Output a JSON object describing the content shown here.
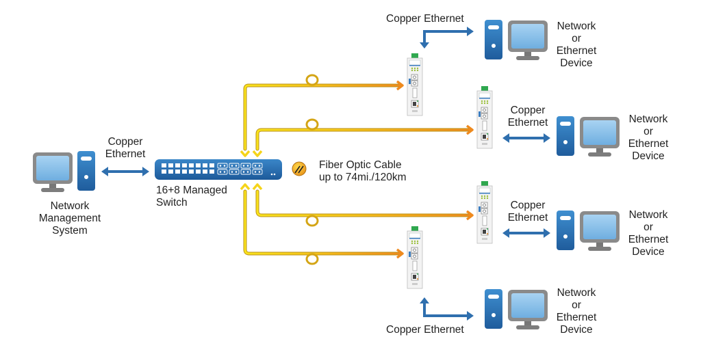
{
  "diagram": {
    "nms": {
      "label_lines": [
        "Network",
        "Management",
        "System"
      ]
    },
    "nms_link": {
      "label_lines": [
        "Copper",
        "Ethernet"
      ]
    },
    "switch": {
      "label_lines": [
        "16+8 Managed",
        "Switch"
      ],
      "copper_ports": 16,
      "fiber_ports": 8
    },
    "legend": {
      "icon": "fiber-optic-cable-icon",
      "label_lines": [
        "Fiber Optic Cable",
        "up to 74mi./120km"
      ]
    },
    "devices": [
      {
        "label_lines": [
          "Network",
          "or",
          "Ethernet",
          "Device"
        ],
        "link_label": "Copper Ethernet"
      },
      {
        "label_lines": [
          "Network",
          "or",
          "Ethernet",
          "Device"
        ],
        "link_label_lines": [
          "Copper",
          "Ethernet"
        ]
      },
      {
        "label_lines": [
          "Network",
          "or",
          "Ethernet",
          "Device"
        ],
        "link_label_lines": [
          "Copper",
          "Ethernet"
        ]
      },
      {
        "label_lines": [
          "Network",
          "or",
          "Ethernet",
          "Device"
        ],
        "link_label": "Copper Ethernet"
      }
    ],
    "colors": {
      "copper_blue": "#2f6fae",
      "fiber_yellow": "#f7d117",
      "fiber_orange": "#ee8a1e",
      "monitor_gray": "#8a8a8a",
      "screen_blue": "#8fc3ea",
      "converter_green": "#2fa84f"
    }
  }
}
